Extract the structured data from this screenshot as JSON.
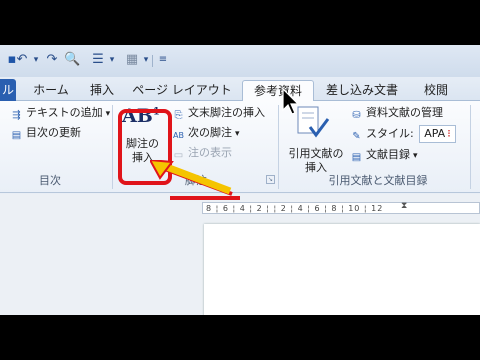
{
  "quick_access": {
    "icons": [
      "save-icon",
      "undo-icon",
      "redo-icon",
      "print-preview-icon",
      "bullets-icon",
      "layout-icon",
      "customize-icon"
    ]
  },
  "tabs": {
    "file_label": "ル",
    "items": [
      {
        "label": "ホーム"
      },
      {
        "label": "挿入"
      },
      {
        "label": "ページ レイアウト"
      },
      {
        "label": "参考資料"
      },
      {
        "label": "差し込み文書"
      },
      {
        "label": "校閲"
      }
    ]
  },
  "ribbon": {
    "toc_group": {
      "add_text": "テキストの追加",
      "update": "目次の更新",
      "label": "目次"
    },
    "footnote_group": {
      "big_icon": "AB",
      "big_sup": "1",
      "big_label_line1": "脚注の",
      "big_label_line2": "挿入",
      "endnote": "文末脚注の挿入",
      "next": "次の脚注",
      "show": "注の表示",
      "label": "脚注"
    },
    "citation_group": {
      "insert_line1": "引用文献の",
      "insert_line2": "挿入",
      "manage": "資料文献の管理",
      "style_label": "スタイル:",
      "style_value": "APA",
      "bibliography": "文献目録",
      "label": "引用文献と文献目録"
    }
  },
  "ruler": {
    "text": "8 ¦ 6 ¦ 4 ¦ 2 ¦ ¦ 2 ¦ 4 ¦ 6 ¦ 8 ¦ 10 ¦ 12"
  },
  "colors": {
    "accent": "#2a5fb0",
    "annotation_red": "#e0141a",
    "arrow_yellow": "#f5c400"
  }
}
